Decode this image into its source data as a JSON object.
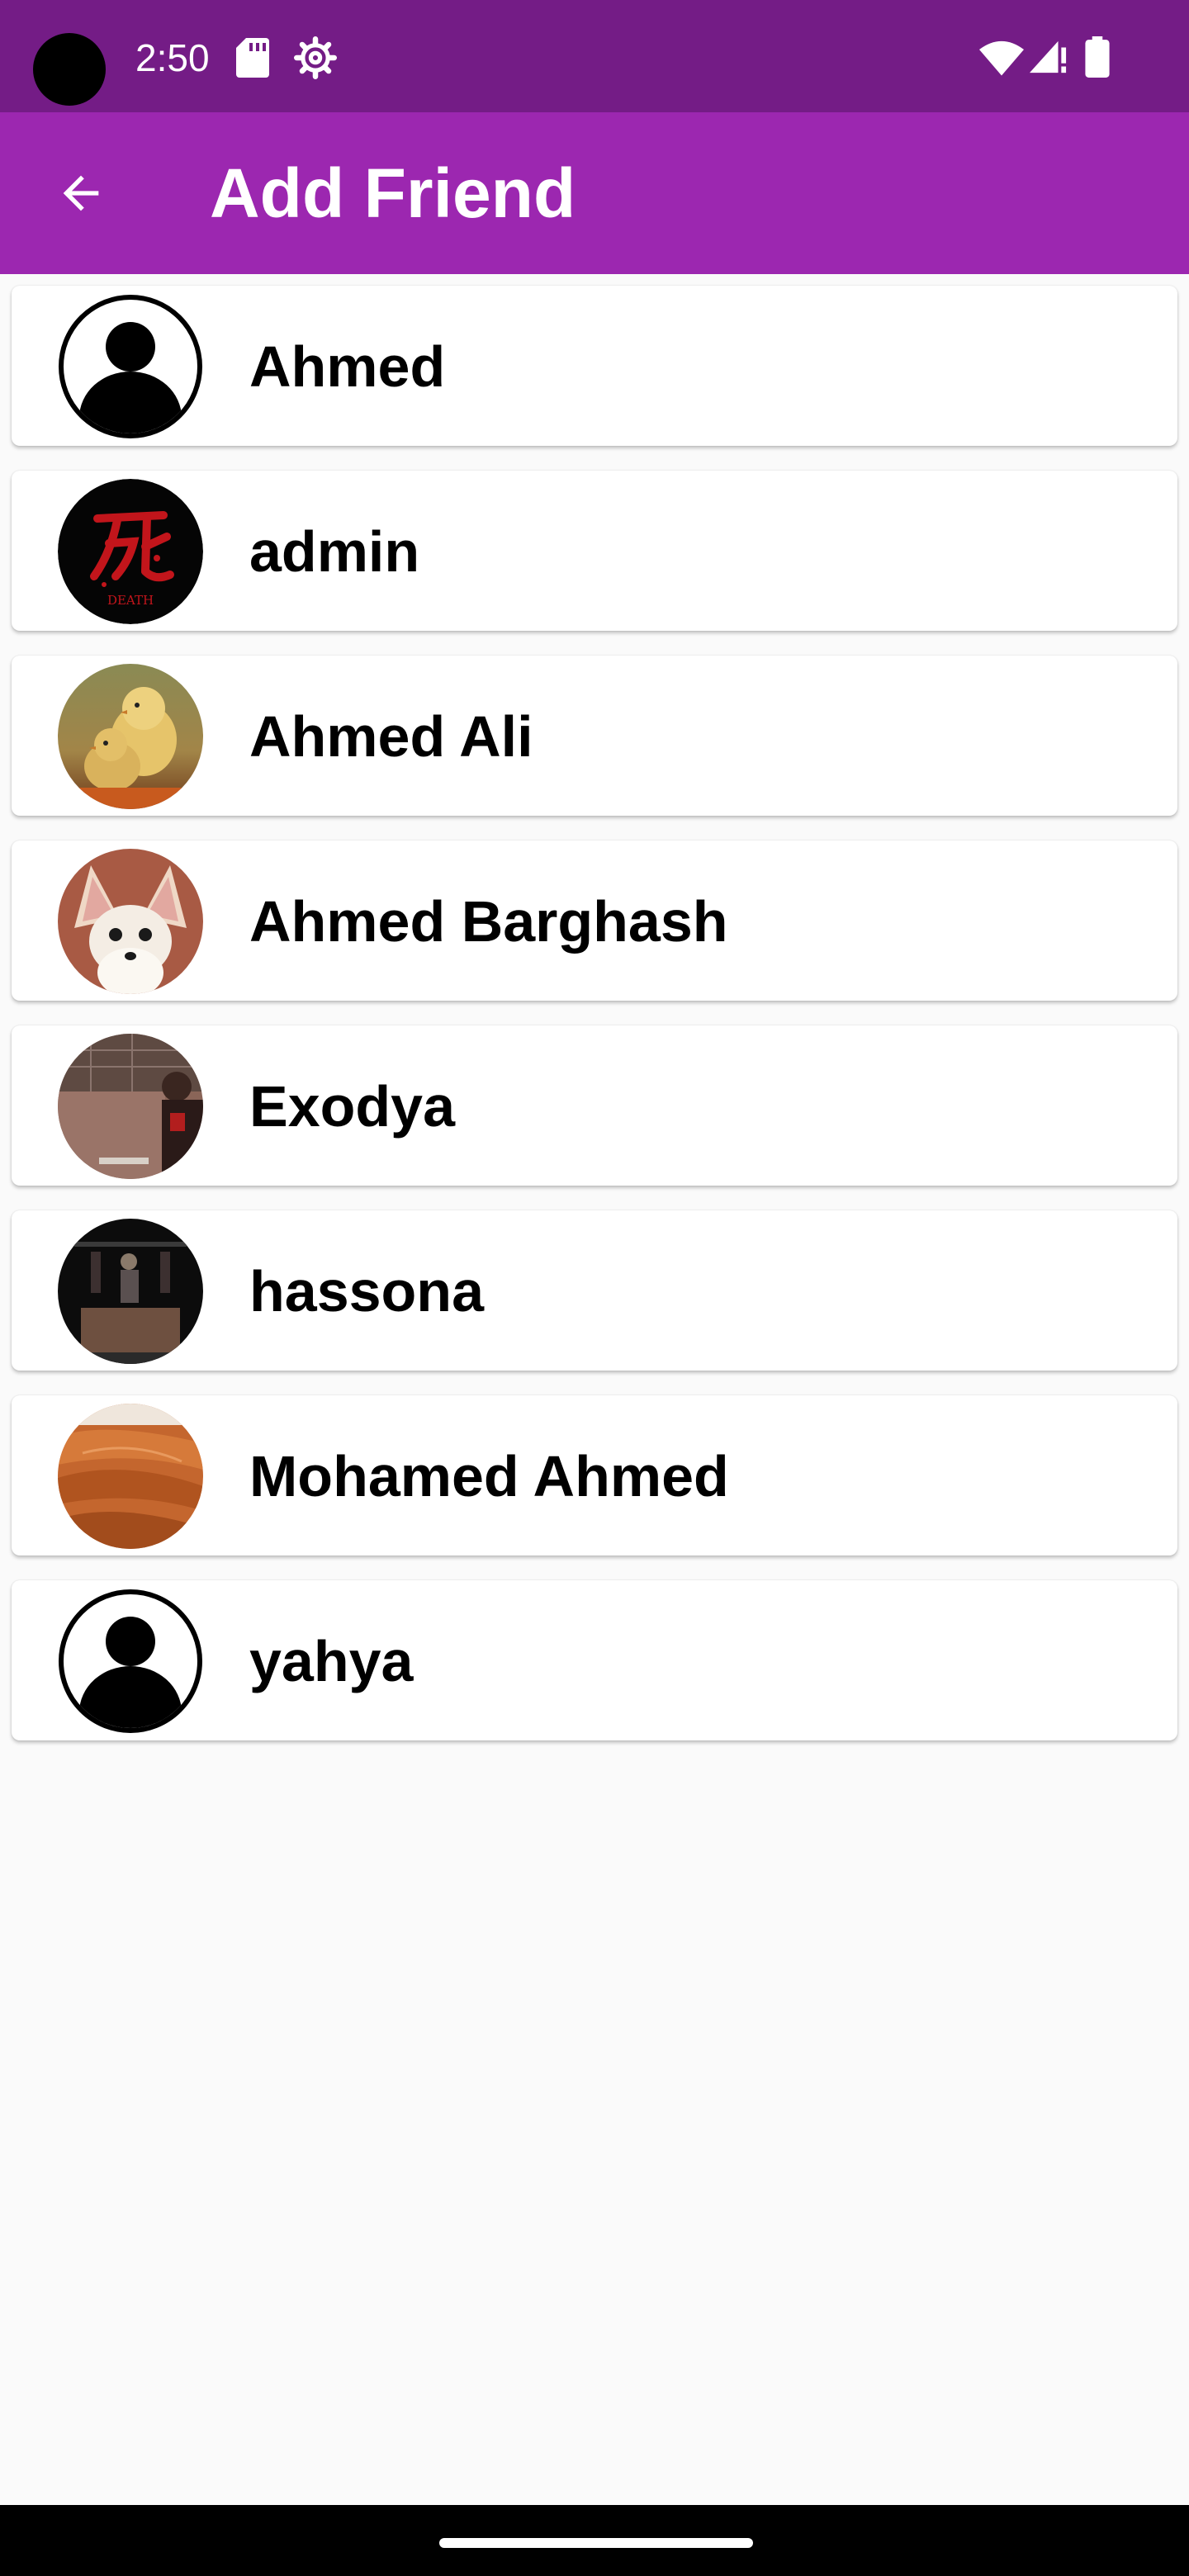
{
  "status_bar": {
    "time": "2:50",
    "icons": [
      "camera-cutout",
      "sd-card-icon",
      "settings-icon",
      "wifi-icon",
      "signal-icon",
      "battery-icon"
    ]
  },
  "app_bar": {
    "title": "Add Friend",
    "back_icon": "arrow-left-icon",
    "background_color": "#9c27b0"
  },
  "users": [
    {
      "name": "Ahmed",
      "avatar": "default-person-avatar"
    },
    {
      "name": "admin",
      "avatar": "death-kanji-avatar"
    },
    {
      "name": "Ahmed Ali",
      "avatar": "chicks-photo-avatar"
    },
    {
      "name": "Ahmed Barghash",
      "avatar": "fennec-fox-photo-avatar"
    },
    {
      "name": "Exodya",
      "avatar": "person-photo-avatar"
    },
    {
      "name": "hassona",
      "avatar": "dark-scene-photo-avatar"
    },
    {
      "name": "Mohamed Ahmed",
      "avatar": "desert-dunes-photo-avatar"
    },
    {
      "name": "yahya",
      "avatar": "default-person-avatar"
    }
  ],
  "colors": {
    "status_bar": "#741c86",
    "app_bar": "#9c27b0",
    "background": "#fafafa",
    "card": "#ffffff"
  }
}
